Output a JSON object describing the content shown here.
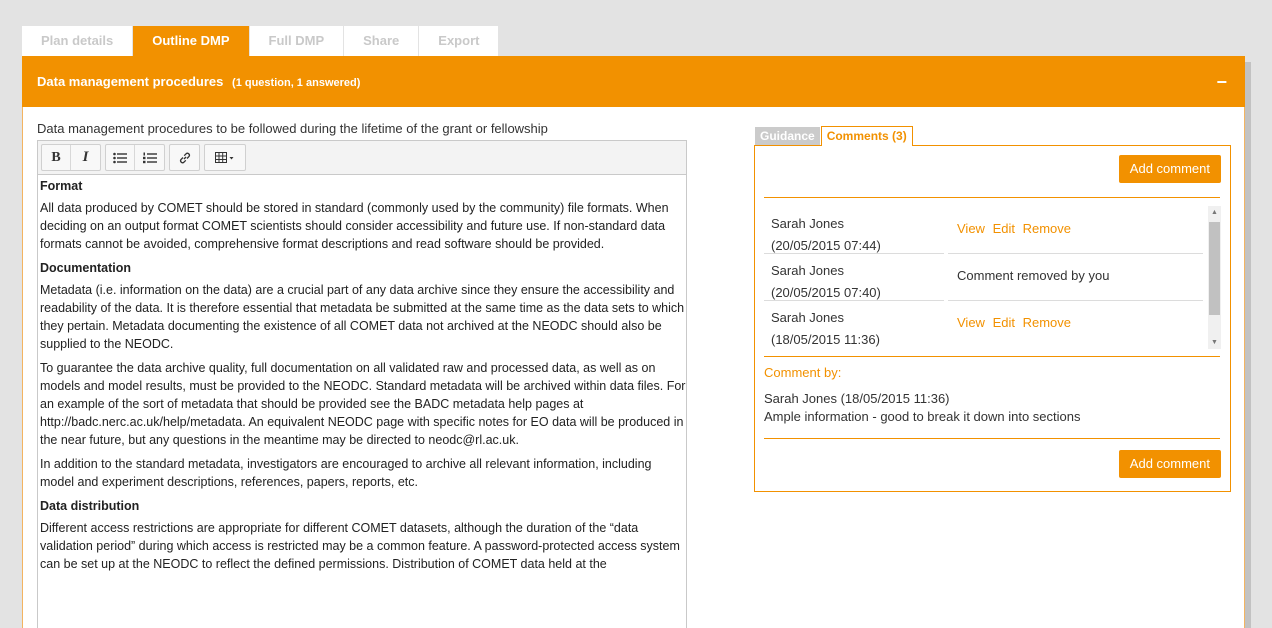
{
  "tabs": [
    "Plan details",
    "Outline DMP",
    "Full DMP",
    "Share",
    "Export"
  ],
  "active_tab": 1,
  "section": {
    "title": "Data management procedures",
    "subtitle": "(1 question, 1 answered)",
    "collapse_symbol": "−"
  },
  "question": {
    "label": "Data management procedures to be followed during the lifetime of the grant or fellowship"
  },
  "toolbar": {
    "bold": "B",
    "italic": "I",
    "bullet_list": "☰",
    "numbered_list": "☰",
    "link": "🔗",
    "table": "▦ ▾"
  },
  "editor": {
    "h_format": "Format",
    "p_format": "All data produced by COMET should be stored in standard (commonly used by the community) file formats. When deciding on an output format COMET scientists should consider accessibility and future use. If non-standard data formats cannot be avoided, comprehensive format descriptions and read software should be provided.",
    "h_documentation": "Documentation",
    "p_documentation_1": "Metadata (i.e. information on the data) are a crucial part of any data archive since they ensure the accessibility and readability of the data. It is therefore essential that metadata be submitted at the same time as the data sets to which they pertain. Metadata documenting the existence of all COMET data not archived at the NEODC should also be supplied to the NEODC.",
    "p_documentation_2": "To guarantee the data archive quality, full documentation on all validated raw and processed data, as well as on models and model results, must be provided to the NEODC. Standard metadata will be archived within data files. For an example of the sort of metadata that should be provided see the BADC metadata help pages at  http://badc.nerc.ac.uk/help/metadata. An equivalent NEODC page with specific notes for EO data will be produced in the near future, but any questions in the meantime may be directed to neodc@rl.ac.uk.",
    "p_documentation_3": "In addition to the standard metadata, investigators are encouraged to archive all relevant information, including model and experiment descriptions, references, papers, reports, etc.",
    "h_distribution": "Data distribution",
    "p_distribution": "Different access restrictions are appropriate for different COMET datasets, although the duration of the “data validation period” during which access is restricted may be a common feature. A password-protected access system can be set up at the NEODC to reflect the defined permissions. Distribution of COMET data held at the"
  },
  "side_panel": {
    "tab_guidance": "Guidance",
    "tab_comments": "Comments (3)",
    "add_comment": "Add comment",
    "comments": [
      {
        "name": "Sarah Jones",
        "date": "(20/05/2015 07:44)",
        "actions": [
          "View",
          "Edit",
          "Remove"
        ],
        "note": ""
      },
      {
        "name": "Sarah Jones",
        "date": "(20/05/2015 07:40)",
        "actions": [],
        "note": "Comment removed by you"
      },
      {
        "name": "Sarah Jones",
        "date": "(18/05/2015 11:36)",
        "actions": [
          "View",
          "Edit",
          "Remove"
        ],
        "note": ""
      }
    ],
    "comment_by_label": "Comment by:",
    "selected_comment_author": "Sarah Jones (18/05/2015 11:36)",
    "selected_comment_text": "Ample information - good to break it down into sections"
  },
  "colors": {
    "accent": "#f29100",
    "tab_inactive_text": "#c9c9c9",
    "background": "#e3e3e3"
  }
}
